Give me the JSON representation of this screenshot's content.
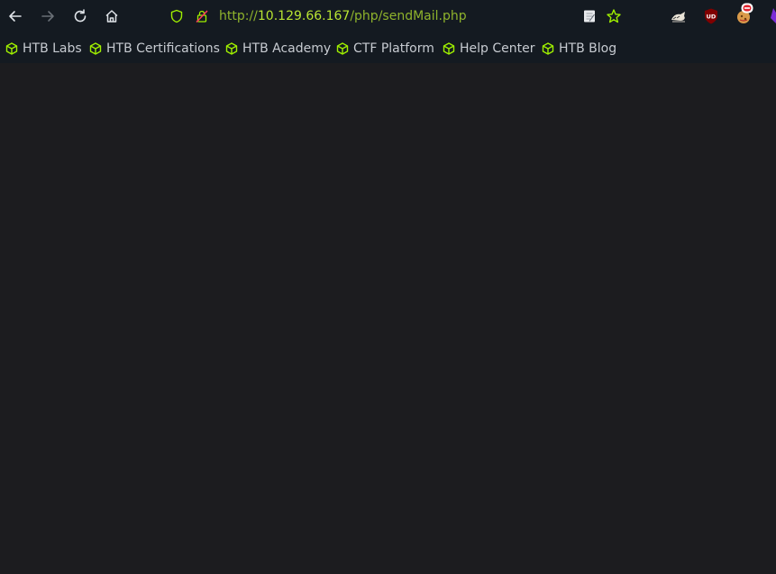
{
  "nav": {
    "back_icon": "arrow-left-icon",
    "forward_icon": "arrow-right-icon",
    "reload_icon": "reload-icon",
    "home_icon": "home-icon"
  },
  "urlbar": {
    "scheme": "http://",
    "host": "10.129.66.167",
    "path": "/php/sendMail.php"
  },
  "bookmarks": [
    {
      "label": "HTB Labs"
    },
    {
      "label": "HTB Certifications"
    },
    {
      "label": "HTB Academy"
    },
    {
      "label": "CTF Platform"
    },
    {
      "label": "Help Center"
    },
    {
      "label": "HTB Blog"
    }
  ],
  "extensions": {
    "ublock_badge": "UD"
  },
  "colors": {
    "toolbar_bg": "#141a21",
    "page_bg": "#1c1c1f",
    "accent_green": "#9fef00",
    "url_host": "#b9e532"
  }
}
